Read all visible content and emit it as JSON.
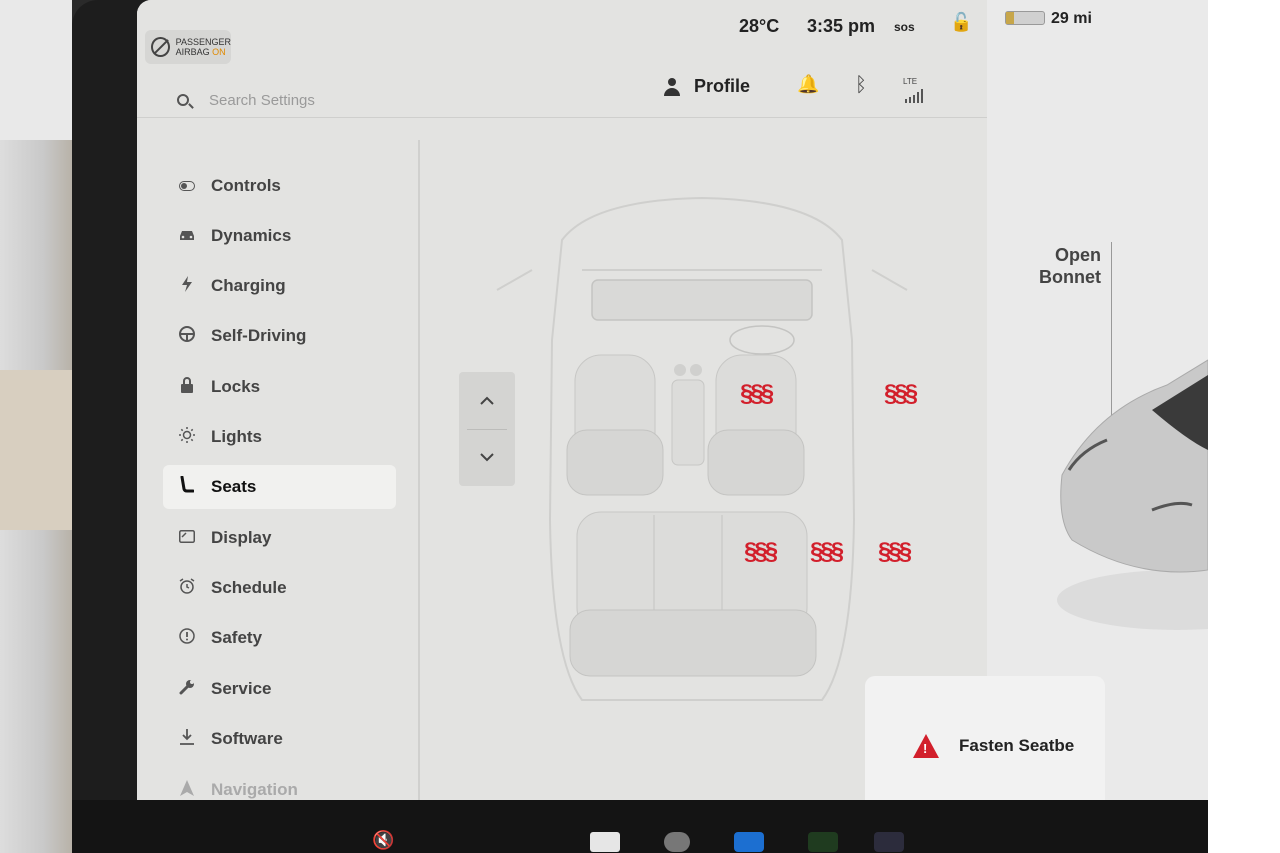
{
  "airbag": {
    "line1": "PASSENGER",
    "line2": "AIRBAG",
    "state": "ON"
  },
  "status": {
    "temperature": "28°C",
    "time": "3:35 pm",
    "sos": "sos",
    "range": "29 mi",
    "network": "LTE"
  },
  "search": {
    "placeholder": "Search Settings"
  },
  "profile": {
    "label": "Profile"
  },
  "nav": [
    {
      "label": "Controls",
      "icon": "toggle-icon"
    },
    {
      "label": "Dynamics",
      "icon": "car-icon"
    },
    {
      "label": "Charging",
      "icon": "bolt-icon"
    },
    {
      "label": "Self-Driving",
      "icon": "steering-wheel-icon"
    },
    {
      "label": "Locks",
      "icon": "lock-icon"
    },
    {
      "label": "Lights",
      "icon": "sun-icon"
    },
    {
      "label": "Seats",
      "icon": "seat-icon",
      "active": true
    },
    {
      "label": "Display",
      "icon": "display-icon"
    },
    {
      "label": "Schedule",
      "icon": "alarm-clock-icon"
    },
    {
      "label": "Safety",
      "icon": "alert-circle-icon"
    },
    {
      "label": "Service",
      "icon": "wrench-icon"
    },
    {
      "label": "Software",
      "icon": "download-icon"
    },
    {
      "label": "Navigation",
      "icon": "navigation-arrow-icon"
    }
  ],
  "seats": {
    "heater_glyph": "§§§",
    "heated": [
      "driver",
      "front-passenger",
      "rear-left",
      "rear-center",
      "rear-right"
    ],
    "heater_color": "#d21f2b"
  },
  "car": {
    "bonnet_line1": "Open",
    "bonnet_line2": "Bonnet"
  },
  "alert": {
    "text": "Fasten Seatbe",
    "color": "#d21f2b"
  },
  "colors": {
    "screen_bg": "#e4e4e2",
    "active_item_bg": "#f1f1ef",
    "accent_red": "#d21f2b"
  }
}
